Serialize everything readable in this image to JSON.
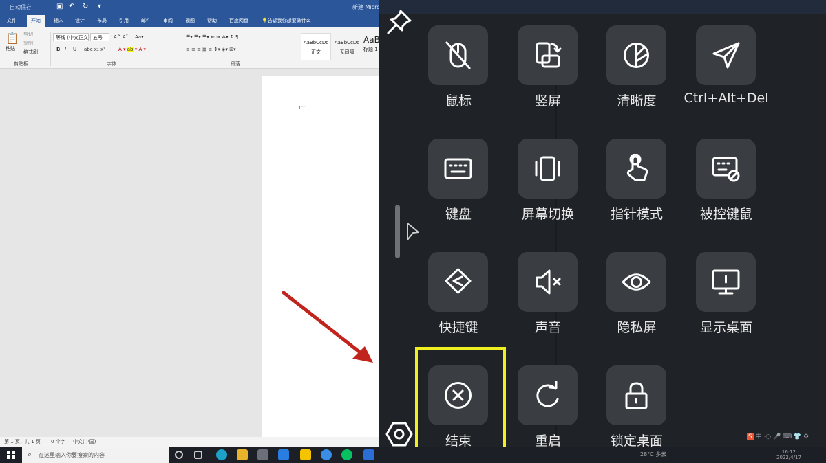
{
  "word": {
    "title": "新建 Microsoft Word 文档",
    "quick_access": "自动保存",
    "tabs": [
      "文件",
      "开始",
      "插入",
      "设计",
      "布局",
      "引用",
      "邮件",
      "审阅",
      "视图",
      "帮助",
      "百度网盘"
    ],
    "active_tab": "开始",
    "tell_me": "告诉我你想要做什么",
    "clipboard": {
      "paste": "粘贴",
      "cut": "剪切",
      "copy": "复制",
      "format_painter": "格式刷",
      "group": "剪贴板"
    },
    "font": {
      "name": "等线 (中文正文)",
      "size": "五号",
      "group": "字体",
      "bold": "B",
      "italic": "I",
      "underline": "U"
    },
    "paragraph": {
      "group": "段落"
    },
    "styles": [
      {
        "preview": "AaBbCcDc",
        "name": "正文"
      },
      {
        "preview": "AaBbCcDc",
        "name": "无间隔"
      },
      {
        "preview": "AaBl",
        "name": "标题 1"
      }
    ],
    "status": {
      "page": "第 1 页，共 1 页",
      "words": "0 个字",
      "lang": "中文(中国)"
    }
  },
  "taskbar": {
    "search_placeholder": "在这里输入你要搜索的内容",
    "weather": "28°C 多云",
    "time": "16:12",
    "date": "2022/4/17"
  },
  "overlay": {
    "grid": [
      {
        "label": "鼠标",
        "icon": "mouse-off-icon"
      },
      {
        "label": "竖屏",
        "icon": "rotate-screen-icon"
      },
      {
        "label": "清晰度",
        "icon": "clarity-icon"
      },
      {
        "label": "Ctrl+Alt+Del",
        "icon": "send-icon"
      },
      {
        "label": "键盘",
        "icon": "keyboard-icon"
      },
      {
        "label": "屏幕切换",
        "icon": "screen-switch-icon"
      },
      {
        "label": "指针模式",
        "icon": "pointer-hand-icon"
      },
      {
        "label": "被控键鼠",
        "icon": "keyboard-disabled-icon"
      },
      {
        "label": "快捷键",
        "icon": "shortcut-icon"
      },
      {
        "label": "声音",
        "icon": "mute-icon"
      },
      {
        "label": "隐私屏",
        "icon": "eye-icon"
      },
      {
        "label": "显示桌面",
        "icon": "monitor-icon"
      },
      {
        "label": "结束",
        "icon": "close-circle-icon"
      },
      {
        "label": "重启",
        "icon": "restart-icon"
      },
      {
        "label": "锁定桌面",
        "icon": "lock-icon"
      }
    ],
    "highlight_color": "#f0ef1f",
    "arrow_color": "#c0241c"
  }
}
